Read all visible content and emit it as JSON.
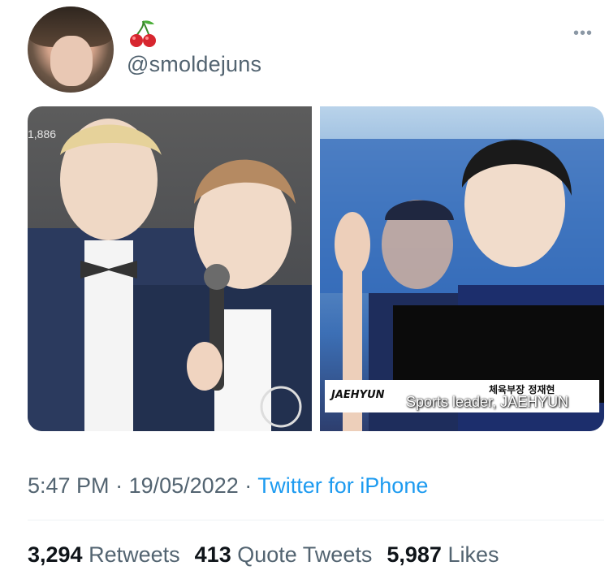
{
  "author": {
    "handle": "@smoldejuns",
    "avatar_icon": "profile-photo",
    "name_emoji": "cherry-icon"
  },
  "media": {
    "left_overlay_count": "1,886",
    "right_caption": {
      "name_tag": "JAEHYUN",
      "korean": "체육부장 정재현",
      "english": "Sports leader, JAEHYUN"
    }
  },
  "meta": {
    "time": "5:47 PM",
    "date": "19/05/2022",
    "separator": "·",
    "source": "Twitter for iPhone"
  },
  "stats": {
    "retweets_count": "3,294",
    "retweets_label": "Retweets",
    "quotes_count": "413",
    "quotes_label": "Quote Tweets",
    "likes_count": "5,987",
    "likes_label": "Likes"
  },
  "colors": {
    "text_primary": "#0f1419",
    "text_secondary": "#536471",
    "link": "#1d9bf0"
  }
}
